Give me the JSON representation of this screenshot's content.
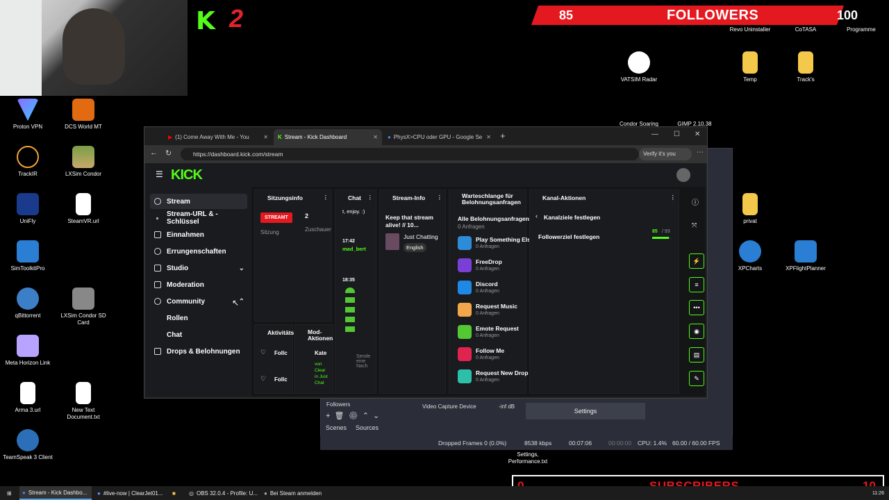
{
  "overlay": {
    "kick_counter": "2",
    "followers": {
      "count": "85",
      "label": "FOLLOWERS",
      "goal": "100"
    },
    "subscribers": {
      "count": "0",
      "label": "SUBSCRIBERS",
      "goal": "10"
    }
  },
  "desktop_icons": [
    {
      "label": "Proton VPN"
    },
    {
      "label": "DCS World MT"
    },
    {
      "label": "TrackIR"
    },
    {
      "label": "LXSim Condor"
    },
    {
      "label": "UniFly"
    },
    {
      "label": "SteamVR.url"
    },
    {
      "label": "SimToolkitPro"
    },
    {
      "label": "qBittorrent"
    },
    {
      "label": "LXSim Condor SD Card"
    },
    {
      "label": "Meta Horizon Link"
    },
    {
      "label": "Arma 3.url"
    },
    {
      "label": "New Text Document.txt"
    },
    {
      "label": "TeamSpeak 3 Client"
    },
    {
      "label": "Revo Uninstaller"
    },
    {
      "label": "CoTASA"
    },
    {
      "label": "Programme"
    },
    {
      "label": "VATSIM Radar"
    },
    {
      "label": "Temp"
    },
    {
      "label": "Track's"
    },
    {
      "label": "Condor Soaring"
    },
    {
      "label": "GIMP 2.10.38"
    },
    {
      "label": "privat"
    },
    {
      "label": "XPCharts"
    },
    {
      "label": "XPFlightPlanner"
    },
    {
      "label": "Settings, Performance.txt"
    }
  ],
  "browser": {
    "tabs": [
      {
        "label": "(1) Come Away With Me - You"
      },
      {
        "label": "Stream - Kick Dashboard"
      },
      {
        "label": "PhysX>CPU oder GPU - Google Se"
      }
    ],
    "url": "https://dashboard.kick.com/stream",
    "verify": "Verify it's you"
  },
  "kick": {
    "logo": "KICK",
    "sidebar": [
      {
        "label": "Stream"
      },
      {
        "label": "Stream-URL & -Schlüssel"
      },
      {
        "label": "Einnahmen"
      },
      {
        "label": "Errungenschaften"
      },
      {
        "label": "Studio"
      },
      {
        "label": "Moderation"
      },
      {
        "label": "Community"
      },
      {
        "label": "Rollen"
      },
      {
        "label": "Chat"
      },
      {
        "label": "Drops & Belohnungen"
      }
    ],
    "session": {
      "title": "Sitzungsinfo",
      "status": "STREAMT",
      "status_label": "Sitzung",
      "viewers": "2",
      "viewers_label": "Zuschauer"
    },
    "chat": {
      "title": "Chat",
      "msg1": "t, enjoy. :)",
      "time1": "17:42",
      "user1": "mad_bert",
      "time2": "18:35",
      "send_placeholder": "Sende eine Nach"
    },
    "stream_info": {
      "title": "Stream-Info",
      "stream_title": "Keep that stream alive! // 10...",
      "category": "Just Chatting",
      "language": "English"
    },
    "activity": {
      "title": "Aktivitäts",
      "item1": "Follc",
      "item2": "Follc"
    },
    "mod_actions": {
      "title": "Mod-Aktionen",
      "item": "Kate",
      "sub": "von Clear in Just Chat"
    },
    "queue": {
      "title": "Warteschlange für Belohnungsanfragen",
      "all": "Alle Belohnungsanfragen",
      "all_count": "0 Anfragen",
      "items": [
        {
          "name": "Play Something Els",
          "count": "0 Anfragen",
          "color": "#2d8bd8"
        },
        {
          "name": "FreeDrop",
          "count": "0 Anfragen",
          "color": "#7a3fd6"
        },
        {
          "name": "Discord",
          "count": "0 Anfragen",
          "color": "#1e88e5"
        },
        {
          "name": "Request Music",
          "count": "0 Anfragen",
          "color": "#f3a64a"
        },
        {
          "name": "Emote Request",
          "count": "0 Anfragen",
          "color": "#53c832"
        },
        {
          "name": "Follow Me",
          "count": "0 Anfragen",
          "color": "#e0244f"
        },
        {
          "name": "Request New Drop",
          "count": "0 Anfragen",
          "color": "#2dbfa8"
        }
      ]
    },
    "channel_actions": {
      "title": "Kanal-Aktionen",
      "back": "Kanalziele festlegen",
      "goal_label": "Followerziel festlegen",
      "goal_value": "85",
      "goal_total": "/ 93",
      "goal_progress": 0.914
    }
  },
  "obs": {
    "source1": "Followers",
    "source2": "Video Capture Device",
    "db": "-inf dB",
    "settings": "Settings",
    "scenes": "Scenes",
    "sources": "Sources",
    "dropped": "Dropped Frames 0 (0.0%)",
    "kbps": "8538 kbps",
    "time1": "00:07:06",
    "time2": "00:00:00",
    "cpu": "CPU: 1.4%",
    "fps": "60.00 / 60.00 FPS"
  },
  "taskbar": [
    {
      "label": "Stream - Kick Dashbo..."
    },
    {
      "label": "#live-now | ClearJet01..."
    },
    {
      "label": ""
    },
    {
      "label": "OBS 32.0.4 - Profile: U..."
    },
    {
      "label": "Bei Steam anmelden"
    }
  ],
  "clock": "11:26"
}
